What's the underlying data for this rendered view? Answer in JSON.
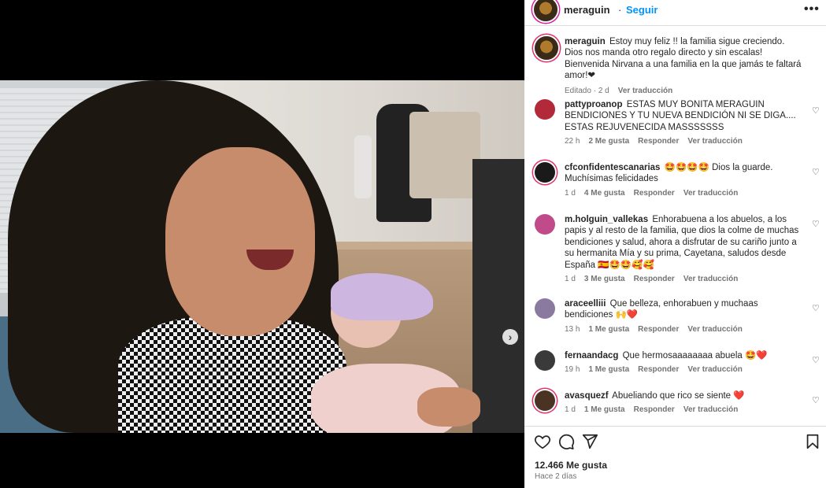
{
  "post": {
    "username": "meraguin",
    "separator": "·",
    "follow_label": "Seguir",
    "more_label": "•••",
    "caption": "Estoy muy feliz !! la familia sigue creciendo. Dios nos manda otro regalo directo y sin escalas! Bienvenida Nirvana a una familia en la que jamás te faltará amor!❤",
    "caption_meta": {
      "edited": "Editado",
      "dot": "·",
      "age": "2 d",
      "translate": "Ver traducción"
    },
    "likes": "12.466 Me gusta",
    "posted": "Hace 2 días",
    "next_label": "›"
  },
  "comments": [
    {
      "user": "pattyproanop",
      "text": "ESTAS MUY BONITA MERAGUIN BENDICIONES Y TU NUEVA BENDICIÓN NI SE DIGA.... ESTAS REJUVENECIDA MASSSSSSS",
      "emoji": "",
      "age": "22 h",
      "likes": "2 Me gusta",
      "reply": "Responder",
      "translate": "Ver traducción",
      "avatar_color": "#b22a3a"
    },
    {
      "user": "cfconfidentescanarias",
      "text": "Dios la guarde. Muchísimas felicidades",
      "emoji_lead": "🤩🤩🤩🤩",
      "age": "1 d",
      "likes": "4 Me gusta",
      "reply": "Responder",
      "translate": "Ver traducción",
      "avatar_color": "#1a1a1a"
    },
    {
      "user": "m.holguin_vallekas",
      "text": "Enhorabuena a los abuelos, a los papis y al resto de la familia, que dios la colme de muchas bendiciones y salud, ahora a disfrutar de su cariño junto a su hermanita Mía y su prima, Cayetana, saludos desde España",
      "emoji": "🇪🇦🤩🤩🥰🥰",
      "age": "1 d",
      "likes": "3 Me gusta",
      "reply": "Responder",
      "translate": "Ver traducción",
      "avatar_color": "#c04a8a"
    },
    {
      "user": "araceelliii",
      "text": "Que belleza, enhorabuen y muchaas bendiciones",
      "emoji": "🙌❤️",
      "age": "13 h",
      "likes": "1 Me gusta",
      "reply": "Responder",
      "translate": "Ver traducción",
      "avatar_color": "#8a7aa0"
    },
    {
      "user": "fernaandacg",
      "text": "Que hermosaaaaaaaa abuela",
      "emoji": "🤩❤️",
      "age": "19 h",
      "likes": "1 Me gusta",
      "reply": "Responder",
      "translate": "Ver traducción",
      "avatar_color": "#3a3a3a"
    },
    {
      "user": "avasquezf",
      "text": "Abueliando que rico se siente",
      "emoji": "❤️",
      "age": "1 d",
      "likes": "1 Me gusta",
      "reply": "Responder",
      "translate": "Ver traducción",
      "avatar_color": "#4a3322"
    }
  ],
  "icons": {
    "like": "heart-outline-icon",
    "comment": "comment-bubble-icon",
    "share": "paper-plane-icon",
    "save": "bookmark-icon",
    "comment_like": "heart-small-icon"
  },
  "colors": {
    "accent": "#0095f6",
    "muted": "#737373",
    "text": "#262626",
    "heart": "#e0245e"
  }
}
